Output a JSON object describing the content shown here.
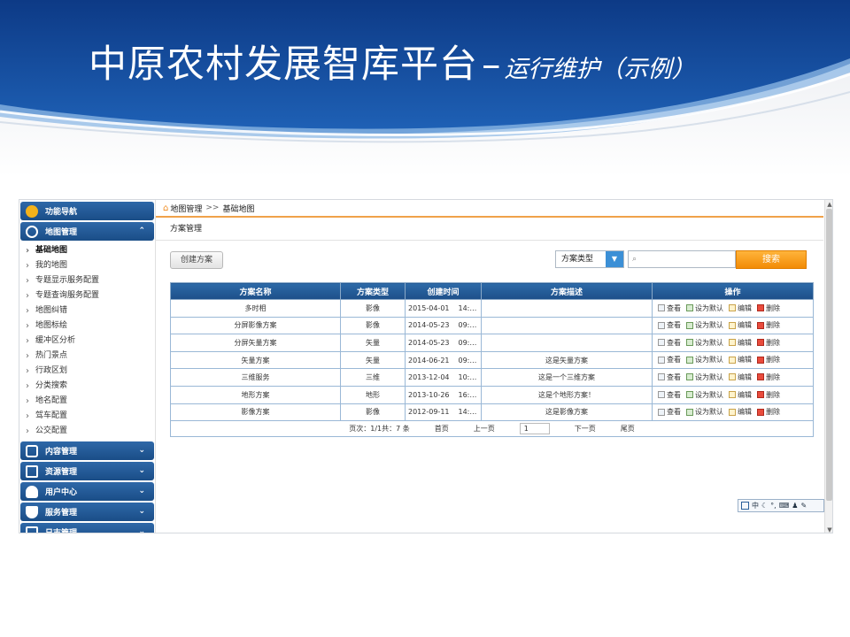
{
  "slide": {
    "title_main": "中原农村发展智库平台",
    "title_dash": "–",
    "title_sub": "运行维护（示例）"
  },
  "sidebar": {
    "nav_title": "功能导航",
    "sections": [
      {
        "label": "地图管理",
        "expanded": true,
        "icon": "globe-icon"
      },
      {
        "label": "内容管理",
        "expanded": false,
        "icon": "content-icon"
      },
      {
        "label": "资源管理",
        "expanded": false,
        "icon": "list-icon"
      },
      {
        "label": "用户中心",
        "expanded": false,
        "icon": "users-icon"
      },
      {
        "label": "服务管理",
        "expanded": false,
        "icon": "shield-icon"
      },
      {
        "label": "日志管理",
        "expanded": false,
        "icon": "log-icon"
      }
    ],
    "map_items": [
      "基础地图",
      "我的地图",
      "专题显示服务配置",
      "专题查询服务配置",
      "地图纠错",
      "地图标绘",
      "缓冲区分析",
      "热门景点",
      "行政区划",
      "分类搜索",
      "地名配置",
      "驾车配置",
      "公交配置"
    ],
    "active_item": "基础地图"
  },
  "breadcrumb": {
    "root": "地图管理",
    "separator": ">>",
    "current": "基础地图"
  },
  "panel": {
    "title": "方案管理"
  },
  "toolbar": {
    "create_label": "创建方案",
    "type_select": "方案类型",
    "search_placeholder": "",
    "search_label": "搜索"
  },
  "table": {
    "headers": [
      "方案名称",
      "方案类型",
      "创建时间",
      "方案描述",
      "操作"
    ],
    "rows": [
      {
        "name": "多时相",
        "type": "影像",
        "created": "2015-04-01",
        "time": "14:…",
        "desc": ""
      },
      {
        "name": "分屏影像方案",
        "type": "影像",
        "created": "2014-05-23",
        "time": "09:…",
        "desc": ""
      },
      {
        "name": "分屏矢量方案",
        "type": "矢量",
        "created": "2014-05-23",
        "time": "09:…",
        "desc": ""
      },
      {
        "name": "矢量方案",
        "type": "矢量",
        "created": "2014-06-21",
        "time": "09:…",
        "desc": "这是矢量方案"
      },
      {
        "name": "三维服务",
        "type": "三维",
        "created": "2013-12-04",
        "time": "10:…",
        "desc": "这是一个三维方案"
      },
      {
        "name": "地形方案",
        "type": "地形",
        "created": "2013-10-26",
        "time": "16:…",
        "desc": "这是个地形方案！"
      },
      {
        "name": "影像方案",
        "type": "影像",
        "created": "2012-09-11",
        "time": "14:…",
        "desc": "这是影像方案"
      }
    ],
    "actions": [
      "查看",
      "设为默认",
      "编辑",
      "删除"
    ],
    "pager": {
      "info": "页次：1/1共：7 条",
      "first": "首页",
      "prev": "上一页",
      "page": "1",
      "next": "下一页",
      "last": "尾页"
    }
  },
  "ime_bar": {
    "lang": "中"
  }
}
